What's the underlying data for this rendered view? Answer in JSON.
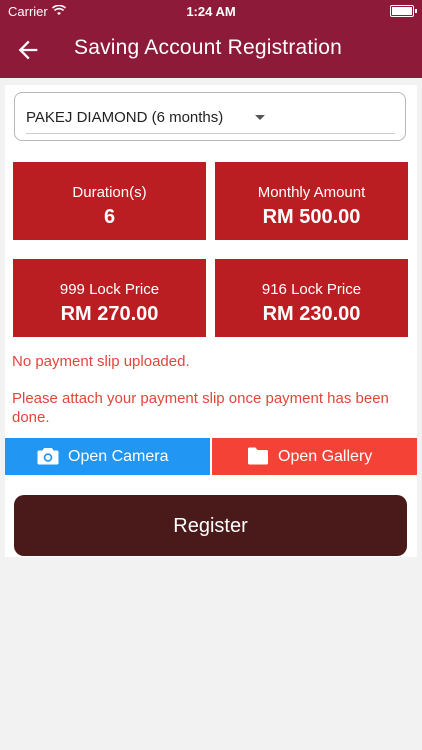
{
  "status": {
    "carrier": "Carrier",
    "time": "1:24 AM"
  },
  "appbar": {
    "title": "Saving Account Registration"
  },
  "package": {
    "selected": "PAKEJ DIAMOND (6 months)"
  },
  "tiles": [
    {
      "label": "Duration(s)",
      "value": "6"
    },
    {
      "label": "Monthly Amount",
      "value": "RM 500.00"
    },
    {
      "label": "999 Lock Price",
      "value": "RM 270.00"
    },
    {
      "label": "916 Lock Price",
      "value": "RM 230.00"
    }
  ],
  "messages": {
    "no_slip": "No payment slip uploaded.",
    "attach_hint": "Please attach your payment slip once payment has been done."
  },
  "actions": {
    "open_camera": "Open Camera",
    "open_gallery": "Open Gallery",
    "register": "Register"
  },
  "colors": {
    "appbar": "#8e1a3a",
    "tile": "#bb1e22",
    "camera_button": "#2196f3",
    "gallery_button": "#f44336",
    "register_button": "#4a1a1a",
    "error_text": "#e2463a"
  },
  "icons": {
    "back": "arrow-left-icon",
    "camera": "camera-icon",
    "gallery": "folder-icon",
    "wifi": "wifi-icon",
    "battery": "battery-icon"
  }
}
